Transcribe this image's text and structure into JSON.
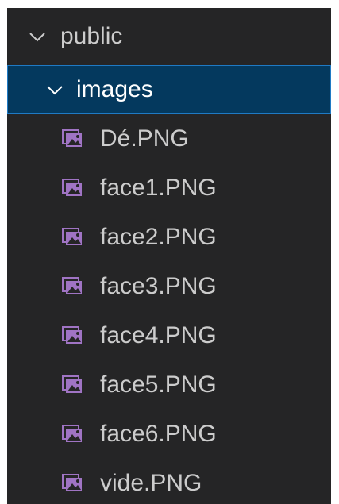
{
  "explorer": {
    "root_folder": {
      "label": "public",
      "icon": "chevron-down-icon"
    },
    "sub_folder": {
      "label": "images",
      "icon": "chevron-down-icon",
      "selected": true
    },
    "files": [
      {
        "label": "Dé.PNG",
        "icon": "image-file-icon"
      },
      {
        "label": "face1.PNG",
        "icon": "image-file-icon"
      },
      {
        "label": "face2.PNG",
        "icon": "image-file-icon"
      },
      {
        "label": "face3.PNG",
        "icon": "image-file-icon"
      },
      {
        "label": "face4.PNG",
        "icon": "image-file-icon"
      },
      {
        "label": "face5.PNG",
        "icon": "image-file-icon"
      },
      {
        "label": "face6.PNG",
        "icon": "image-file-icon"
      },
      {
        "label": "vide.PNG",
        "icon": "image-file-icon"
      }
    ],
    "colors": {
      "background": "#252526",
      "text": "#cccccc",
      "selected_bg": "#04395e",
      "selected_border": "#1f7ac4",
      "image_icon": "#a074c4"
    }
  }
}
